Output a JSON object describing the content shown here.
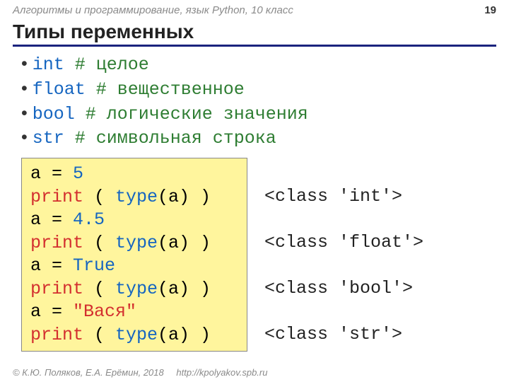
{
  "header": {
    "course": "Алгоритмы и программирование, язык Python, 10 класс",
    "page": "19"
  },
  "title": "Типы переменных",
  "bullets": [
    {
      "kw": "int",
      "pad": "    ",
      "comment": "# целое"
    },
    {
      "kw": "float",
      "pad": "  ",
      "comment": "# вещественное"
    },
    {
      "kw": "bool",
      "pad": "   ",
      "comment": "# логические значения"
    },
    {
      "kw": "str",
      "pad": "  ",
      "comment": "# символьная строка"
    }
  ],
  "code": {
    "l1a": "a = ",
    "l1b": "5",
    "l2a": "print",
    "l2b": " ( ",
    "l2c": "type",
    "l2d": "(a) )",
    "l3a": "a = ",
    "l3b": "4.5",
    "l4a": "print",
    "l4b": " ( ",
    "l4c": "type",
    "l4d": "(a) )",
    "l5a": "a = ",
    "l5b": "True",
    "l6a": "print",
    "l6b": " ( ",
    "l6c": "type",
    "l6d": "(a) )",
    "l7a": "a = ",
    "l7b": "\"Вася\"",
    "l8a": "print",
    "l8b": " ( ",
    "l8c": "type",
    "l8d": "(a) )"
  },
  "output": {
    "o1": "",
    "o2": "<class 'int'>",
    "o3": "",
    "o4": "<class 'float'>",
    "o5": "",
    "o6": "<class 'bool'>",
    "o7": "",
    "o8": "<class 'str'>"
  },
  "footer": {
    "copy": "© К.Ю. Поляков, Е.А. Ерёмин, 2018",
    "url": "http://kpolyakov.spb.ru"
  }
}
